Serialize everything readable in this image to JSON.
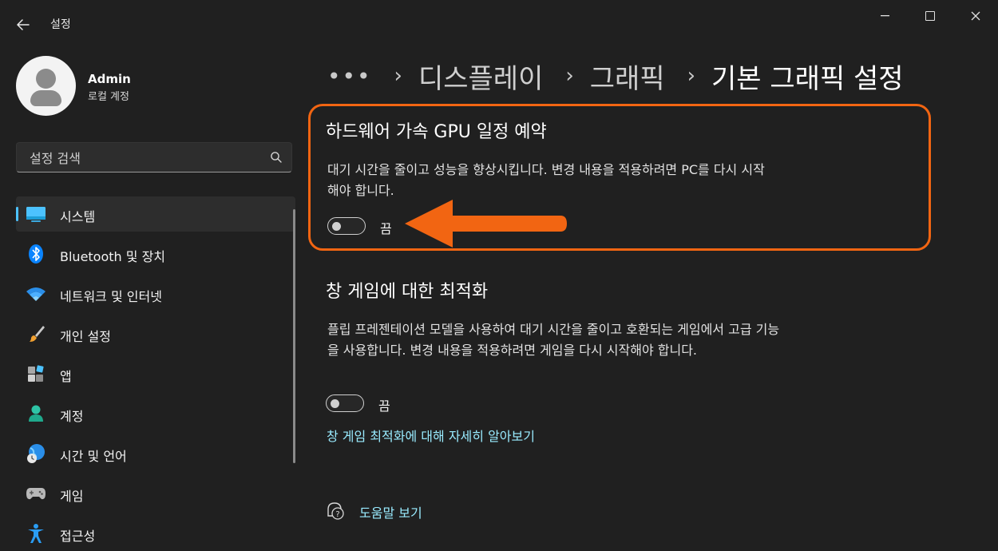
{
  "window": {
    "app_title": "설정"
  },
  "profile": {
    "name": "Admin",
    "account_type": "로컬 계정"
  },
  "search": {
    "placeholder": "설정 검색"
  },
  "sidebar": {
    "items": [
      {
        "label": "시스템",
        "icon": "system-display-icon",
        "active": true
      },
      {
        "label": "Bluetooth 및 장치",
        "icon": "bluetooth-icon"
      },
      {
        "label": "네트워크 및 인터넷",
        "icon": "wifi-icon"
      },
      {
        "label": "개인 설정",
        "icon": "paintbrush-icon"
      },
      {
        "label": "앱",
        "icon": "apps-icon"
      },
      {
        "label": "계정",
        "icon": "account-icon"
      },
      {
        "label": "시간 및 언어",
        "icon": "globe-clock-icon"
      },
      {
        "label": "게임",
        "icon": "gamepad-icon"
      },
      {
        "label": "접근성",
        "icon": "accessibility-icon"
      }
    ]
  },
  "breadcrumb": {
    "more": "•••",
    "items": [
      "디스플레이",
      "그래픽"
    ],
    "current": "기본 그래픽 설정"
  },
  "sections": [
    {
      "title": "하드웨어 가속 GPU 일정 예약",
      "description": "대기 시간을 줄이고 성능을 향상시킵니다. 변경 내용을 적용하려면 PC를 다시 시작해야 합니다.",
      "toggle_state": "끔",
      "enabled": false
    },
    {
      "title": "창 게임에 대한 최적화",
      "description": "플립 프레젠테이션 모델을 사용하여 대기 시간을 줄이고 호환되는 게임에서 고급 기능을 사용합니다. 변경 내용을 적용하려면 게임을 다시 시작해야 합니다.",
      "toggle_state": "끔",
      "enabled": false,
      "link": "창 게임 최적화에 대해 자세히 알아보기"
    }
  ],
  "help": {
    "label": "도움말 보기"
  },
  "colors": {
    "highlight": "#f26512",
    "accent": "#4cc2ff",
    "link": "#99ebff",
    "background": "#202020"
  }
}
